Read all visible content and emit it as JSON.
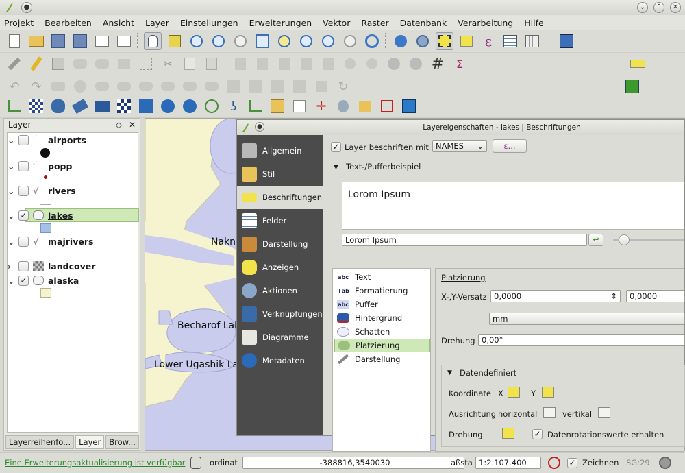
{
  "window": {
    "app_icon": "qgis-icon"
  },
  "menu": [
    "Projekt",
    "Bearbeiten",
    "Ansicht",
    "Layer",
    "Einstellungen",
    "Erweiterungen",
    "Vektor",
    "Raster",
    "Datenbank",
    "Verarbeitung",
    "Hilfe"
  ],
  "layers_panel": {
    "title": "Layer",
    "layers": [
      {
        "name": "airports",
        "checked": false
      },
      {
        "name": "popp",
        "checked": false
      },
      {
        "name": "rivers",
        "checked": false
      },
      {
        "name": "lakes",
        "checked": true
      },
      {
        "name": "majrivers",
        "checked": false
      },
      {
        "name": "landcover",
        "checked": false
      },
      {
        "name": "alaska",
        "checked": true
      }
    ],
    "check_mark": "✓",
    "tabs": [
      "Layerreihenfo...",
      "Layer",
      "Brow..."
    ]
  },
  "map": {
    "labels": [
      "Naknek",
      "Becharof Lak",
      "Lower Ugashik La"
    ],
    "colors": {
      "water": "#c9ccec",
      "land": "#f5f4cf"
    }
  },
  "dialog": {
    "title": "Layereigenschaften - lakes | Beschriftungen",
    "nav": [
      "Allgemein",
      "Stil",
      "Beschriftungen",
      "Felder",
      "Darstellung",
      "Anzeigen",
      "Aktionen",
      "Verknüpfungen",
      "Diagramme",
      "Metadaten"
    ],
    "selected_nav": "Beschriftungen",
    "label_with": "Layer beschriften mit",
    "field_value": "NAMES",
    "expr_button": "ε...",
    "sample_section": "Text-/Pufferbeispiel",
    "preview_text": "Lorom Ipsum",
    "sample_input": "Lorom Ipsum",
    "sublist": [
      "Text",
      "Formatierung",
      "Puffer",
      "Hintergrund",
      "Schatten",
      "Platzierung",
      "Darstellung"
    ],
    "sublist_icons": [
      "abc",
      "+ab",
      "abc",
      "",
      "",
      "",
      "",
      ""
    ],
    "selected_sub": "Platzierung",
    "placement": {
      "header": "Platzierung",
      "offset_label": "X-,Y-Versatz",
      "offset_x": "0,0000",
      "offset_y": "0,0000",
      "unit": "mm",
      "rotation_label": "Drehung",
      "rotation_value": "0,00°",
      "datadef_header": "Datendefiniert",
      "coord_label": "Koordinate",
      "x_label": "X",
      "y_label": "Y",
      "align_label": "Ausrichtung",
      "horizontal": "horizontal",
      "vertical": "vertikal",
      "rot_label": "Drehung",
      "keep_rotation": "Datenrotationswerte erhalten"
    }
  },
  "statusbar": {
    "update_link": "Eine Erweiterungsaktualisierung ist verfügbar",
    "coord_label": "ordinat",
    "coord_value": "-388816,3540030",
    "scale_label": "aßsta",
    "scale_value": "1:2.107.400",
    "render_label": "Zeichnen",
    "srs": "SG:29"
  }
}
